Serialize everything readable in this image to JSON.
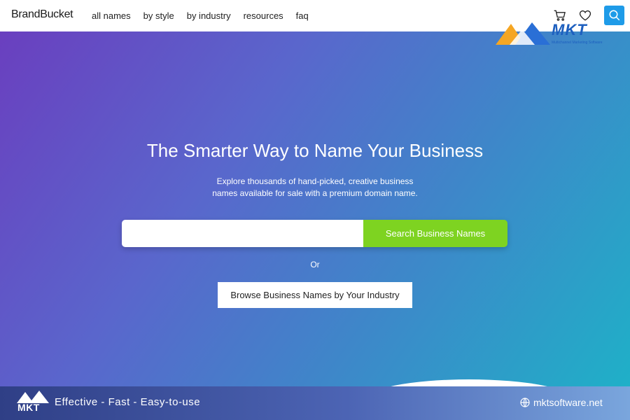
{
  "nav": {
    "logo": "BrandBucket",
    "links": [
      "all names",
      "by style",
      "by industry",
      "resources",
      "faq"
    ]
  },
  "hero": {
    "headline": "The Smarter Way to Name Your Business",
    "subtext": "Explore thousands of hand-picked, creative business names available for sale with a premium domain name.",
    "search_value": "",
    "search_button": "Search Business Names",
    "or": "Or",
    "browse_button": "Browse Business Names by Your Industry"
  },
  "watermark": {
    "brand": "MKT",
    "sub": "Multichannel Marketing Software"
  },
  "footer": {
    "logo": "MKT",
    "tagline": "Effective - Fast - Easy-to-use",
    "site": "mktsoftware.net"
  },
  "colors": {
    "accent_green": "#7ed321",
    "search_blue": "#1e9be8",
    "mkt_blue": "#1d5fbf"
  }
}
